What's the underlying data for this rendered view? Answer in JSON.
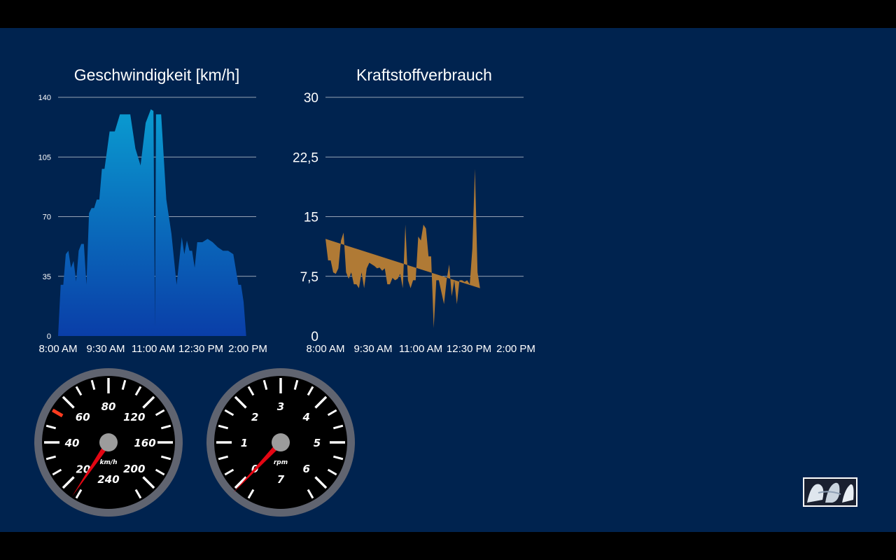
{
  "window": {
    "background": "#00234f",
    "letterbox": "#000000"
  },
  "chart_data": [
    {
      "type": "area",
      "title": "Geschwindigkeit [km/h]",
      "xlabel": "",
      "ylabel": "",
      "x_tick_labels": [
        "8:00 AM",
        "9:30 AM",
        "11:00 AM",
        "12:30 PM",
        "2:00 PM"
      ],
      "x_range": [
        "8:00 AM",
        "2:00 PM"
      ],
      "y_ticks": [
        0,
        35,
        70,
        105,
        140
      ],
      "y_tick_labels": [
        "0",
        "35",
        "70",
        "105",
        "140"
      ],
      "ylim": [
        0,
        140
      ],
      "grid": true,
      "fill_top": "#0a9bd0",
      "fill_bottom": "#0a3ea8",
      "x": [
        "8:00",
        "8:05",
        "8:10",
        "8:15",
        "8:20",
        "8:25",
        "8:30",
        "8:35",
        "8:40",
        "8:45",
        "8:50",
        "8:55",
        "9:00",
        "9:05",
        "9:10",
        "9:15",
        "9:20",
        "9:25",
        "9:30",
        "9:40",
        "9:50",
        "10:00",
        "10:10",
        "10:20",
        "10:30",
        "10:40",
        "10:50",
        "11:00",
        "11:05",
        "11:08",
        "11:10",
        "11:15",
        "11:20",
        "11:30",
        "11:40",
        "11:50",
        "12:00",
        "12:05",
        "12:10",
        "12:15",
        "12:20",
        "12:25",
        "12:30",
        "12:40",
        "12:50",
        "13:00",
        "13:10",
        "13:20",
        "13:30",
        "13:40",
        "13:50",
        "13:55",
        "14:00",
        "14:05"
      ],
      "values": [
        0,
        30,
        30,
        48,
        50,
        40,
        44,
        32,
        50,
        54,
        54,
        30,
        72,
        75,
        75,
        80,
        80,
        98,
        98,
        120,
        120,
        130,
        130,
        130,
        110,
        100,
        125,
        133,
        132,
        5,
        130,
        130,
        130,
        80,
        60,
        30,
        58,
        48,
        56,
        50,
        50,
        40,
        55,
        55,
        57,
        55,
        52,
        50,
        50,
        48,
        30,
        30,
        20,
        0
      ]
    },
    {
      "type": "area",
      "title": "Kraftstoffverbrauch",
      "xlabel": "",
      "ylabel": "",
      "x_tick_labels": [
        "8:00 AM",
        "9:30 AM",
        "11:00 AM",
        "12:30 PM",
        "2:00 PM"
      ],
      "x_range": [
        "8:00 AM",
        "2:00 PM"
      ],
      "y_ticks": [
        0,
        7.5,
        15,
        22.5,
        30
      ],
      "y_tick_labels": [
        "0",
        "7,5",
        "15",
        "22,5",
        "30"
      ],
      "ylim": [
        0,
        30
      ],
      "grid": true,
      "fill": "#b07a35",
      "x": [
        "8:00",
        "8:05",
        "8:10",
        "8:15",
        "8:20",
        "8:25",
        "8:30",
        "8:35",
        "8:40",
        "8:45",
        "8:50",
        "8:55",
        "9:00",
        "9:05",
        "9:10",
        "9:15",
        "9:20",
        "9:25",
        "9:30",
        "9:35",
        "9:40",
        "9:45",
        "9:50",
        "9:55",
        "10:00",
        "10:05",
        "10:10",
        "10:15",
        "10:20",
        "10:25",
        "10:30",
        "10:35",
        "10:40",
        "10:45",
        "10:50",
        "10:55",
        "11:00",
        "11:05",
        "11:10",
        "11:15",
        "11:20",
        "11:25",
        "11:30",
        "11:35",
        "11:40",
        "11:45",
        "11:50",
        "11:55",
        "12:00",
        "12:05",
        "12:10",
        "12:15",
        "12:20",
        "12:25",
        "12:30",
        "12:35",
        "12:40",
        "12:45",
        "12:50",
        "12:55",
        "13:00",
        "13:05",
        "13:10",
        "13:15",
        "13:20",
        "13:25",
        "13:30",
        "13:35",
        "13:40",
        "13:45",
        "13:50",
        "13:55",
        "14:00"
      ],
      "values": [
        12.2,
        9.5,
        9.5,
        8,
        7.8,
        8.5,
        12,
        13,
        8,
        7.2,
        8,
        6.5,
        6.5,
        6,
        8,
        6,
        8.5,
        9.2,
        9,
        8.8,
        8.5,
        8.6,
        8.2,
        8.5,
        6.5,
        6.5,
        7.3,
        7,
        7.2,
        7.8,
        6,
        14,
        7,
        6,
        7,
        7,
        12.5,
        12,
        14,
        13.5,
        10,
        10,
        1,
        7,
        7,
        5.5,
        4,
        7,
        9,
        5,
        7,
        4,
        7,
        7,
        6.8,
        7,
        6.5,
        11,
        21,
        8,
        6
      ]
    }
  ],
  "gauges": [
    {
      "type": "speedometer",
      "unit": "km/h",
      "labels": [
        "20",
        "40",
        "60",
        "80",
        "120",
        "160",
        "200",
        "240"
      ],
      "value": 15,
      "max": 260,
      "redline_marker": true
    },
    {
      "type": "tachometer",
      "unit": "rpm",
      "labels": [
        "0",
        "1",
        "2",
        "3",
        "4",
        "5",
        "6",
        "7"
      ],
      "value": 0.3,
      "max": 7
    }
  ],
  "colors": {
    "needle": "#e30613",
    "dial_face": "#000000",
    "dial_rim": "#606470",
    "hub": "#9c9c9c",
    "redline": "#ff3b1f",
    "grid": "#c8cfd8"
  }
}
